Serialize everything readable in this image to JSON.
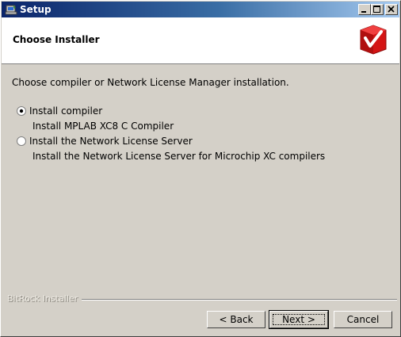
{
  "window": {
    "title": "Setup"
  },
  "header": {
    "title": "Choose Installer"
  },
  "main": {
    "intro": "Choose compiler or Network License Manager installation.",
    "options": [
      {
        "label": "Install compiler",
        "description": "Install MPLAB XC8 C Compiler",
        "selected": true
      },
      {
        "label": "Install the Network License Server",
        "description": "Install the Network License Server for Microchip XC compilers",
        "selected": false
      }
    ]
  },
  "footer": {
    "brand": "BitRock Installer",
    "back_label": "< Back",
    "next_label": "Next >",
    "cancel_label": "Cancel"
  },
  "colors": {
    "title_start": "#0a246a",
    "title_end": "#a6caf0",
    "face": "#d4d0c8",
    "logo_red": "#cc1111"
  }
}
